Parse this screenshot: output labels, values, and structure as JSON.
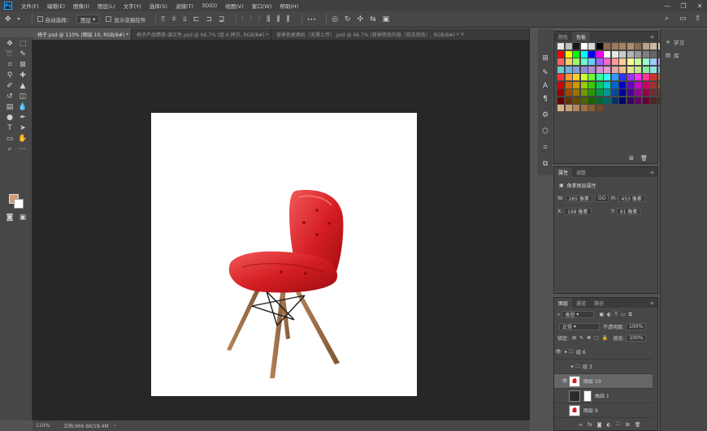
{
  "menubar": {
    "app_icon": "Ps",
    "items": [
      "文件(F)",
      "编辑(E)",
      "图像(I)",
      "图层(L)",
      "文字(Y)",
      "选择(S)",
      "滤镜(T)",
      "3D(D)",
      "视图(V)",
      "窗口(W)",
      "帮助(H)"
    ],
    "window_controls": [
      "—",
      "❐",
      "✕"
    ]
  },
  "options": {
    "auto_select_label": "自动选择：",
    "auto_select_value": "图层",
    "show_transform_label": "显示变换控件",
    "more": "•••"
  },
  "tabs": [
    {
      "label": "椅子.psd @ 110% (图层 10, RGB/8#) *",
      "active": true
    },
    {
      "label": "椅子产品精修-源文件.psd @ 66.7% (组 6 拷贝, RGB/8#) *",
      "active": false
    },
    {
      "label": "背景色更换机（无需上传）.psd @ 66.7% (背景修改内容（双击修改）, RGB/8#) *",
      "active": false
    }
  ],
  "status": {
    "zoom": "110%",
    "doc_info": "文档:966.8K/18.4M"
  },
  "swatches_panel": {
    "tabs": [
      "颜色",
      "色板"
    ],
    "active_tab": "色板",
    "colors": [
      "#e6e6e6",
      "#bfbfbf",
      "#1a1a1a",
      "#ffffff",
      "#d9d9d9",
      "#000000",
      "#8c6a4f",
      "#9d7b5c",
      "#a8825e",
      "#b28d6b",
      "#8a6a50",
      "#b8a48c",
      "#c9b79e",
      "#d8c9b2",
      "#ff0000",
      "#ffff00",
      "#00ff00",
      "#00ffff",
      "#0000ff",
      "#ff00ff",
      "#ffffff",
      "#e8e8e8",
      "#cccccc",
      "#b3b3b3",
      "#999999",
      "#808080",
      "#666666",
      "#4d4d4d",
      "#ff6666",
      "#ffcc66",
      "#99ff66",
      "#66ffcc",
      "#66ccff",
      "#9966ff",
      "#ff66cc",
      "#ff9999",
      "#ffcc99",
      "#ffff99",
      "#ccff99",
      "#99ffcc",
      "#99ccff",
      "#cc99ff",
      "#66cccc",
      "#66b3e6",
      "#7f9fd9",
      "#8c8cd9",
      "#b38cd9",
      "#d98cd9",
      "#e699cc",
      "#e6a3a3",
      "#f0c08c",
      "#e6e68c",
      "#c2e68c",
      "#8ce6a3",
      "#8ce6d9",
      "#8cc2e6",
      "#ff3333",
      "#ff9933",
      "#ffcc33",
      "#ccff33",
      "#66ff33",
      "#33ff99",
      "#33ffff",
      "#3399ff",
      "#3333ff",
      "#9933ff",
      "#ff33ff",
      "#ff3399",
      "#cc3333",
      "#cc6633",
      "#cc0000",
      "#cc6600",
      "#cc9900",
      "#99cc00",
      "#33cc00",
      "#00cc66",
      "#00cccc",
      "#0066cc",
      "#0000cc",
      "#6600cc",
      "#cc00cc",
      "#cc0066",
      "#993333",
      "#996633",
      "#990000",
      "#994c00",
      "#997300",
      "#739900",
      "#269900",
      "#00994c",
      "#009999",
      "#004c99",
      "#000099",
      "#4c0099",
      "#990099",
      "#99004c",
      "#663333",
      "#664433",
      "#660000",
      "#663300",
      "#664d00",
      "#4d6600",
      "#1a6600",
      "#006633",
      "#006666",
      "#003366",
      "#000066",
      "#330066",
      "#660066",
      "#660033",
      "#4d2626",
      "#4d3326",
      "#d9b38c",
      "#c8a070",
      "#b3875a",
      "#9e7045",
      "#8a5c33",
      "#704a29"
    ]
  },
  "properties_panel": {
    "tabs": [
      "属性",
      "调整"
    ],
    "active_tab": "属性",
    "title": "像素图层属性",
    "w_label": "W:",
    "w_value": "265 像素",
    "h_label": "H:",
    "h_value": "453 像素",
    "x_label": "X:",
    "x_value": "168 像素",
    "y_label": "Y:",
    "y_value": "81 像素",
    "link": "GO"
  },
  "layers_panel": {
    "tabs": [
      "图层",
      "通道",
      "路径"
    ],
    "active_tab": "图层",
    "filter_label": "类型",
    "blend_mode": "正常",
    "opacity_label": "不透明度:",
    "opacity_value": "100%",
    "lock_label": "锁定:",
    "fill_label": "填充:",
    "fill_value": "100%",
    "layers": [
      {
        "name": "组 6",
        "kind": "group",
        "visible": true,
        "selected": false
      },
      {
        "name": "组 3",
        "kind": "group",
        "visible": false,
        "selected": false
      },
      {
        "name": "图层 10",
        "kind": "pixel",
        "visible": true,
        "selected": true
      },
      {
        "name": "曲线 1",
        "kind": "adjust",
        "visible": false,
        "selected": false
      },
      {
        "name": "图层 9",
        "kind": "pixel",
        "visible": false,
        "selected": false
      }
    ]
  },
  "right_dock": {
    "items": [
      "学习",
      "库"
    ]
  }
}
